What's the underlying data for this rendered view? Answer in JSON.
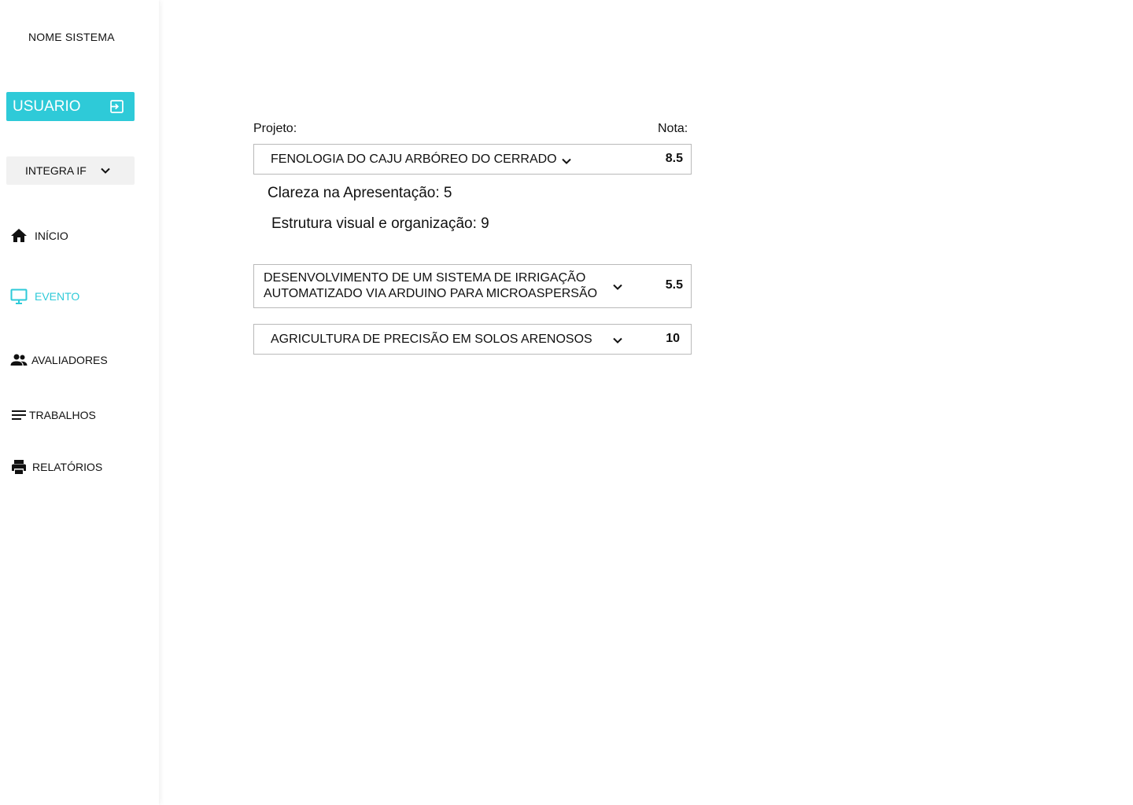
{
  "sidebar": {
    "system_name": "NOME SISTEMA",
    "user_button": {
      "label": "USUARIO",
      "icon": "logout-icon"
    },
    "event_select": {
      "value": "INTEGRA IF",
      "icon": "chevron-down-icon"
    },
    "items": [
      {
        "label": "INÍCIO",
        "icon": "home-icon",
        "active": false
      },
      {
        "label": "EVENTO",
        "icon": "monitor-icon",
        "active": true
      },
      {
        "label": "AVALIADORES",
        "icon": "people-icon",
        "active": false
      },
      {
        "label": "TRABALHOS",
        "icon": "lines-icon",
        "active": false
      },
      {
        "label": "RELATÓRIOS",
        "icon": "printer-icon",
        "active": false
      }
    ]
  },
  "main": {
    "project_label": "Projeto:",
    "score_label": "Nota:",
    "projects": [
      {
        "title": "FENOLOGIA DO CAJU ARBÓREO DO CERRADO",
        "score": "8.5",
        "expanded": true,
        "criteria": [
          "Clareza na Apresentação: 5",
          "Estrutura visual e organização: 9"
        ]
      },
      {
        "title_line1": "DESENVOLVIMENTO DE UM SISTEMA DE IRRIGAÇÃO",
        "title_line2": "AUTOMATIZADO VIA ARDUINO PARA MICROASPERSÃO",
        "score": "5.5",
        "expanded": false
      },
      {
        "title": "AGRICULTURA DE PRECISÃO EM SOLOS ARENOSOS",
        "score": "10",
        "expanded": false
      }
    ]
  },
  "colors": {
    "accent": "#2ecad8",
    "select_bg": "#f1f1f1",
    "row_border": "#b9b9b9"
  }
}
